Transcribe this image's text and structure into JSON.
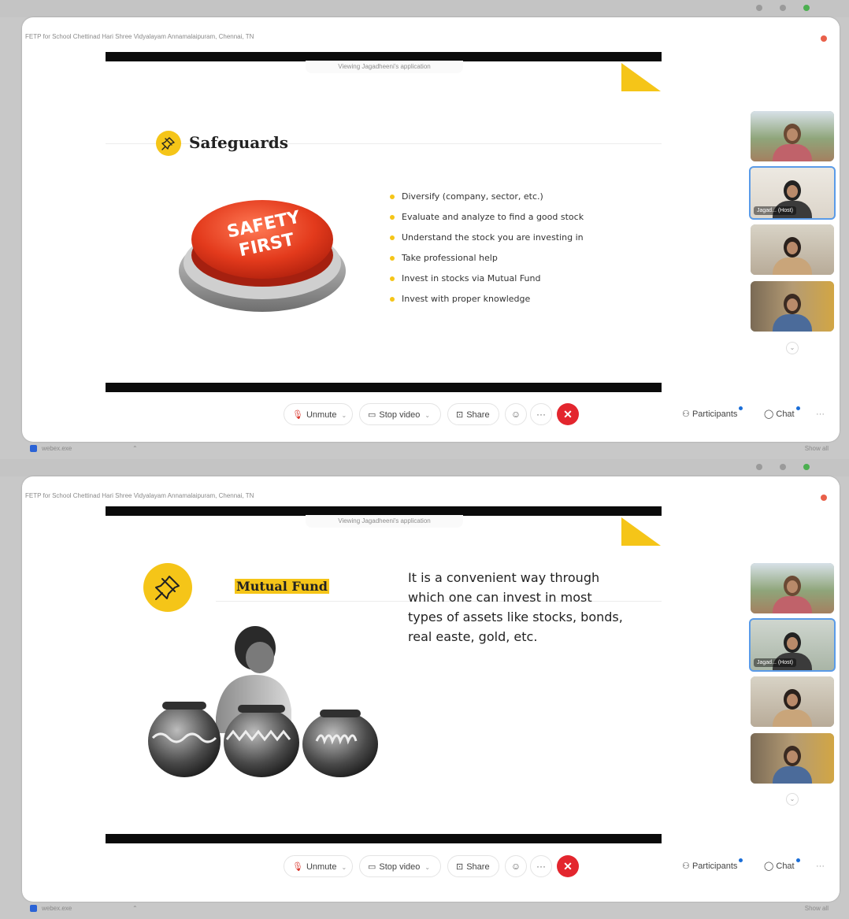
{
  "window_title": "FETP for School Chettinad Hari Shree Vidyalayam Annamalaipuram, Chennai, TN",
  "viewing_banner": "Viewing Jagadheeni's application",
  "controls": {
    "unmute": "Unmute",
    "stop_video": "Stop video",
    "share": "Share",
    "end_icon": "close-icon",
    "participants": "Participants",
    "chat": "Chat"
  },
  "participants": [
    {
      "name": ""
    },
    {
      "name": "Jagad... (Host)"
    },
    {
      "name": ""
    },
    {
      "name": ""
    }
  ],
  "taskbar": {
    "app": "webex.exe",
    "show_all": "Show all"
  },
  "slide1": {
    "title": "Safeguards",
    "button_text_line1": "SAFETY",
    "button_text_line2": "FIRST",
    "bullets": [
      "Diversify (company, sector, etc.)",
      "Evaluate and analyze to find a good stock",
      "Understand the stock you are investing in",
      "Take professional help",
      "Invest in stocks via Mutual Fund",
      "Invest with proper knowledge"
    ]
  },
  "slide2": {
    "title": "Mutual Fund",
    "body": "It is a convenient way through which one can invest in most types of assets like stocks, bonds, real easte, gold, etc."
  },
  "colors": {
    "accent_yellow": "#f5c518",
    "end_red": "#e3262e",
    "notification_blue": "#1a6ed8"
  }
}
